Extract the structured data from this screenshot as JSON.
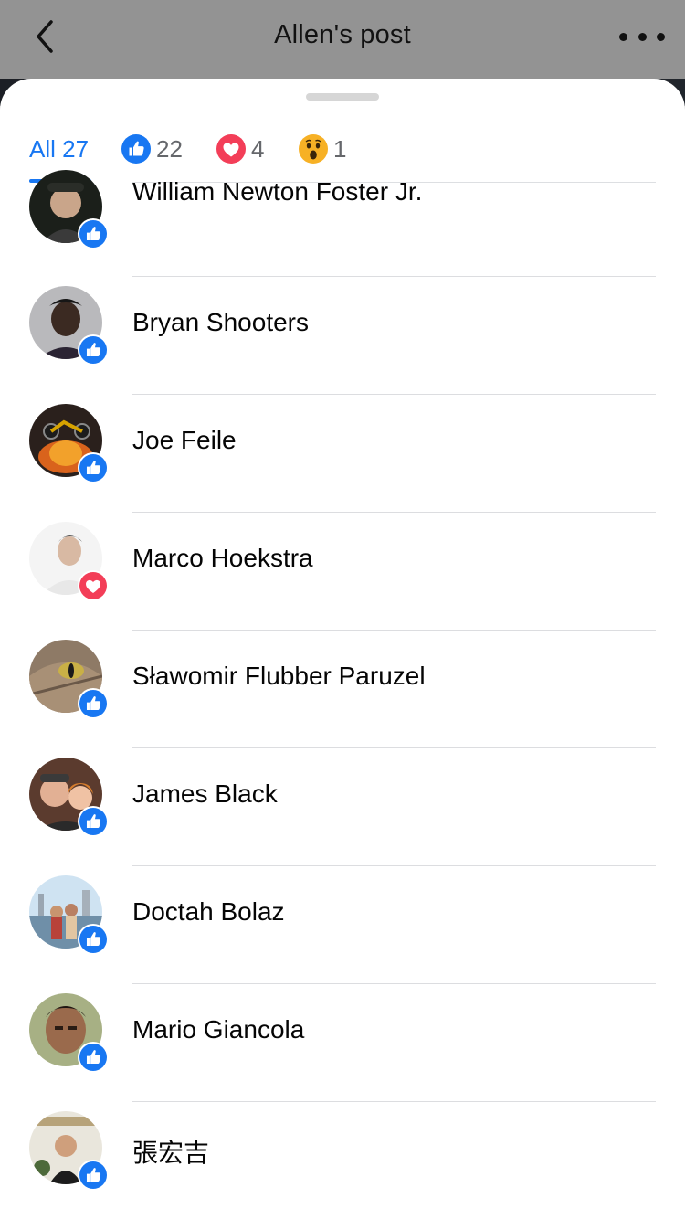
{
  "header": {
    "title": "Allen's post",
    "back_icon": "chevron-left-icon",
    "more_icon": "more-horizontal-icon"
  },
  "tabs": [
    {
      "id": "all",
      "label": "All 27",
      "icon": ""
    },
    {
      "id": "like",
      "label": "22",
      "icon": "like-icon"
    },
    {
      "id": "love",
      "label": "4",
      "icon": "love-icon"
    },
    {
      "id": "wow",
      "label": "1",
      "icon": "wow-icon"
    }
  ],
  "colors": {
    "accent": "#1877f2",
    "love": "#f33e58",
    "wow": "#f7b125"
  },
  "people": [
    {
      "name": "William Newton Foster Jr.",
      "reaction": "like"
    },
    {
      "name": "Bryan Shooters",
      "reaction": "like"
    },
    {
      "name": "Joe Feile",
      "reaction": "like"
    },
    {
      "name": "Marco Hoekstra",
      "reaction": "love"
    },
    {
      "name": "Sławomir Flubber Paruzel",
      "reaction": "like"
    },
    {
      "name": "James Black",
      "reaction": "like"
    },
    {
      "name": "Doctah Bolaz",
      "reaction": "like"
    },
    {
      "name": "Mario Giancola",
      "reaction": "like"
    },
    {
      "name": "張宏吉",
      "reaction": "like"
    }
  ]
}
